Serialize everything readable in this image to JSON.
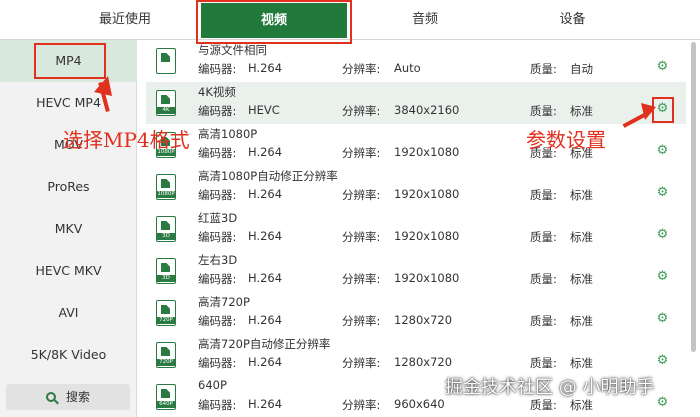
{
  "tabs": [
    {
      "label": "最近使用"
    },
    {
      "label": "视频"
    },
    {
      "label": "音频"
    },
    {
      "label": "设备"
    }
  ],
  "sidebar": {
    "items": [
      {
        "label": "MP4"
      },
      {
        "label": "HEVC MP4"
      },
      {
        "label": "MOV"
      },
      {
        "label": "ProRes"
      },
      {
        "label": "MKV"
      },
      {
        "label": "HEVC MKV"
      },
      {
        "label": "AVI"
      },
      {
        "label": "5K/8K Video"
      }
    ],
    "search_label": "搜索"
  },
  "list": {
    "encoder_label": "编码器:",
    "resolution_label": "分辨率:",
    "quality_label": "质量:",
    "rows": [
      {
        "name": "与源文件相同",
        "encoder": "H.264",
        "resolution": "Auto",
        "quality": "自动",
        "icon_tag": ""
      },
      {
        "name": "4K视频",
        "encoder": "HEVC",
        "resolution": "3840x2160",
        "quality": "标准",
        "icon_tag": "4K"
      },
      {
        "name": "高清1080P",
        "encoder": "H.264",
        "resolution": "1920x1080",
        "quality": "标准",
        "icon_tag": "1080P"
      },
      {
        "name": "高清1080P自动修正分辨率",
        "encoder": "H.264",
        "resolution": "1920x1080",
        "quality": "标准",
        "icon_tag": "1080P"
      },
      {
        "name": "红蓝3D",
        "encoder": "H.264",
        "resolution": "1920x1080",
        "quality": "标准",
        "icon_tag": "3D"
      },
      {
        "name": "左右3D",
        "encoder": "H.264",
        "resolution": "1920x1080",
        "quality": "标准",
        "icon_tag": "3D"
      },
      {
        "name": "高清720P",
        "encoder": "H.264",
        "resolution": "1280x720",
        "quality": "标准",
        "icon_tag": "720P"
      },
      {
        "name": "高清720P自动修正分辨率",
        "encoder": "H.264",
        "resolution": "1280x720",
        "quality": "标准",
        "icon_tag": "720P"
      },
      {
        "name": "640P",
        "encoder": "H.264",
        "resolution": "960x640",
        "quality": "标准",
        "icon_tag": "640P"
      }
    ]
  },
  "annotations": {
    "select_format": "选择MP4格式",
    "param_settings": "参数设置"
  },
  "watermark": "掘金技术社区 @ 小明助手",
  "colors": {
    "accent_green": "#217a3c",
    "annotation_red": "#e0301e",
    "selected_row_bg": "#eaf1ec",
    "sidebar_active_bg": "#d9e8dc"
  }
}
